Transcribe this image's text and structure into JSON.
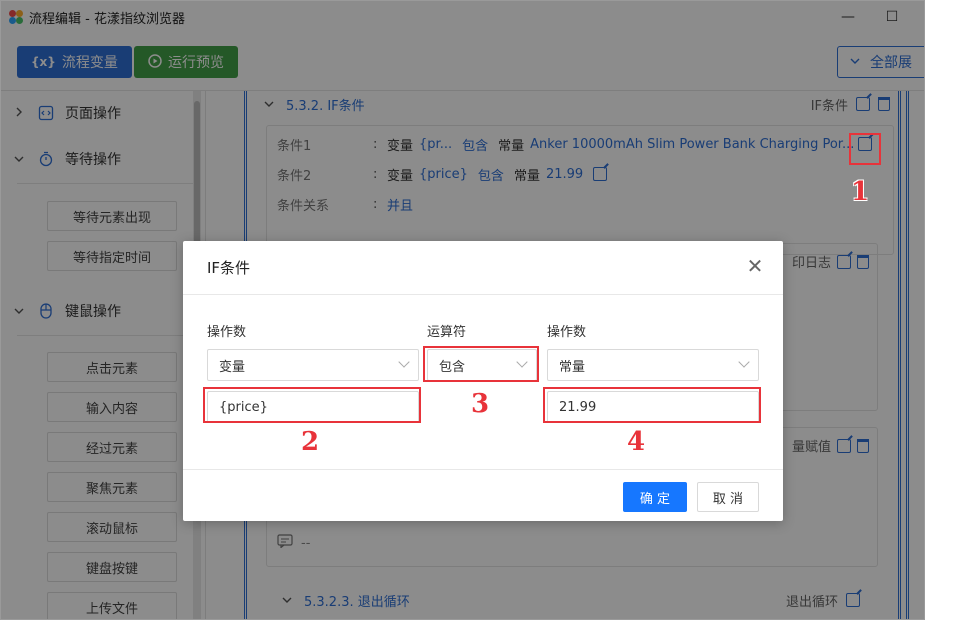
{
  "window": {
    "title": "流程编辑 - 花漾指纹浏览器",
    "minimize_glyph": "—",
    "maximize_glyph": "☐"
  },
  "toolbar": {
    "vars_label": "流程变量",
    "vars_icon": "{x}",
    "run_label": "运行预览",
    "expand_label": "全部展"
  },
  "sidebar": {
    "categories": [
      {
        "label": "页面操作",
        "icon": "page-code-icon"
      },
      {
        "label": "等待操作",
        "icon": "stopwatch-icon"
      },
      {
        "label": "键鼠操作",
        "icon": "mouse-icon"
      }
    ],
    "wait_items": [
      "等待元素出现",
      "等待指定时间"
    ],
    "input_items": [
      "点击元素",
      "输入内容",
      "经过元素",
      "聚焦元素",
      "滚动鼠标",
      "键盘按键",
      "上传文件"
    ]
  },
  "flow": {
    "node_title": "5.3.2. IF条件",
    "node_type": "IF条件",
    "conditions": [
      {
        "label": "条件1",
        "sep": ":",
        "left_kind": "变量",
        "left_value": "{pr...",
        "operator": "包含",
        "right_kind": "常量",
        "right_value": "Anker 10000mAh Slim Power Bank Charging Por..."
      },
      {
        "label": "条件2",
        "sep": ":",
        "left_kind": "变量",
        "left_value": "{price}",
        "operator": "包含",
        "right_kind": "常量",
        "right_value": "21.99"
      }
    ],
    "relation_label": "条件关系",
    "relation_sep": ":",
    "relation_value": "并且",
    "sub1_type": "印日志",
    "sub2_type": "量赋值",
    "comment_placeholder": "--",
    "next_node_title": "5.3.2.3. 退出循环",
    "next_node_type": "退出循环"
  },
  "dialog": {
    "title": "IF条件",
    "close_glyph": "✕",
    "operand_left_label": "操作数",
    "operator_label": "运算符",
    "operand_right_label": "操作数",
    "left_type": "变量",
    "operator_value": "包含",
    "right_type": "常量",
    "left_value": "{price}",
    "right_value": "21.99",
    "ok_label": "确 定",
    "cancel_label": "取 消"
  },
  "annotations": {
    "n1": "1",
    "n2": "2",
    "n3": "3",
    "n4": "4"
  },
  "colors": {
    "primary": "#2f6fd6",
    "success": "#43a047",
    "dialog_primary": "#1677ff",
    "highlight": "#e8333a"
  }
}
